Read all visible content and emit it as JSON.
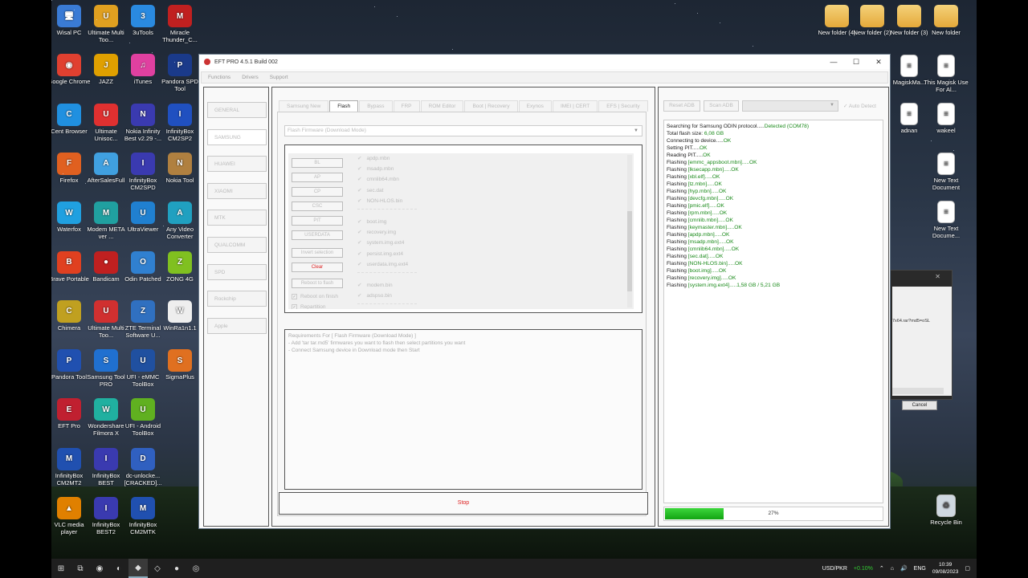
{
  "desktop": {
    "left_icons": [
      {
        "label": "Wisal PC",
        "glyph": "🖥",
        "color": "#3a7bd5"
      },
      {
        "label": "Ultimate Multi Too...",
        "glyph": "U",
        "color": "#e0a020"
      },
      {
        "label": "3uTools",
        "glyph": "3",
        "color": "#2a8ae0"
      },
      {
        "label": "Miracle Thunder_C...",
        "glyph": "M",
        "color": "#c02020"
      },
      {
        "label": "Google Chrome",
        "glyph": "◉",
        "color": "#e04030"
      },
      {
        "label": "JAZZ",
        "glyph": "J",
        "color": "#e0a000"
      },
      {
        "label": "iTunes",
        "glyph": "♫",
        "color": "#e040a0"
      },
      {
        "label": "Pandora SPD Tool",
        "glyph": "P",
        "color": "#1a3a8a"
      },
      {
        "label": "Cent Browser",
        "glyph": "C",
        "color": "#2090e0"
      },
      {
        "label": "Ultimate Unisoc...",
        "glyph": "U",
        "color": "#e03030"
      },
      {
        "label": "Nokia Infinity Best v2.29 -...",
        "glyph": "N",
        "color": "#3a3ab0"
      },
      {
        "label": "InfinityBox CM2SP2",
        "glyph": "I",
        "color": "#2050c0"
      },
      {
        "label": "Firefox",
        "glyph": "F",
        "color": "#e06020"
      },
      {
        "label": "AfterSalesFull",
        "glyph": "A",
        "color": "#40a0e0"
      },
      {
        "label": "InfinityBox CM2SPD",
        "glyph": "I",
        "color": "#3a3ab0"
      },
      {
        "label": "Nokia Tool",
        "glyph": "N",
        "color": "#b08040"
      },
      {
        "label": "Waterfox",
        "glyph": "W",
        "color": "#20a0e0"
      },
      {
        "label": "Modem META ver ...",
        "glyph": "M",
        "color": "#20a0a0"
      },
      {
        "label": "UltraViewer",
        "glyph": "U",
        "color": "#2080d0"
      },
      {
        "label": "Any Video Converter",
        "glyph": "A",
        "color": "#20a0c0"
      },
      {
        "label": "Brave Portable",
        "glyph": "B",
        "color": "#e04020"
      },
      {
        "label": "Bandicam",
        "glyph": "●",
        "color": "#c02020"
      },
      {
        "label": "Odin Patched",
        "glyph": "O",
        "color": "#3080d0"
      },
      {
        "label": "ZONG 4G",
        "glyph": "Z",
        "color": "#80c020"
      },
      {
        "label": "Chimera",
        "glyph": "C",
        "color": "#c0a020"
      },
      {
        "label": "Ultimate Multi Too...",
        "glyph": "U",
        "color": "#d03030"
      },
      {
        "label": "ZTE Terminal Software U...",
        "glyph": "Z",
        "color": "#3070c0"
      },
      {
        "label": "WinRa1n1.1",
        "glyph": "W",
        "color": "#eeeeee"
      },
      {
        "label": "Pandora Tool",
        "glyph": "P",
        "color": "#2050b0"
      },
      {
        "label": "Samsung Tool PRO",
        "glyph": "S",
        "color": "#2070d0"
      },
      {
        "label": "UFI - eMMC ToolBox",
        "glyph": "U",
        "color": "#2050a0"
      },
      {
        "label": "SigmaPlus",
        "glyph": "S",
        "color": "#e07020"
      },
      {
        "label": "EFT Pro",
        "glyph": "E",
        "color": "#c02030"
      },
      {
        "label": "Wondershare Filmora X",
        "glyph": "W",
        "color": "#20b0a0"
      },
      {
        "label": "UFI - Android ToolBox",
        "glyph": "U",
        "color": "#60b020"
      },
      {
        "label": "",
        "glyph": "",
        "color": "transparent"
      },
      {
        "label": "InfinityBox CM2MT2",
        "glyph": "M",
        "color": "#2050b0"
      },
      {
        "label": "InfinityBox BEST",
        "glyph": "I",
        "color": "#3a3ab0"
      },
      {
        "label": "dc-unlocke... [CRACKED]...",
        "glyph": "D",
        "color": "#3060c0"
      },
      {
        "label": "",
        "glyph": "",
        "color": "transparent"
      },
      {
        "label": "VLC media player",
        "glyph": "▲",
        "color": "#e08000"
      },
      {
        "label": "InfinityBox BEST2",
        "glyph": "I",
        "color": "#3a3ab0"
      },
      {
        "label": "InfinityBox CM2MTK",
        "glyph": "M",
        "color": "#2050b0"
      }
    ],
    "right_icons": [
      {
        "label": "New folder (4)",
        "kind": "folder"
      },
      {
        "label": "New folder (2)",
        "kind": "folder"
      },
      {
        "label": "New folder (3)",
        "kind": "folder"
      },
      {
        "label": "New folder",
        "kind": "folder"
      },
      {
        "label": "MagiskMa...",
        "kind": "doc"
      },
      {
        "label": "This Magisk Use For Al...",
        "kind": "doc"
      },
      {
        "label": "adnan",
        "kind": "doc"
      },
      {
        "label": "wakeel",
        "kind": "doc"
      },
      {
        "label": "New Text Document",
        "kind": "doc"
      },
      {
        "label": "New Text Docume...",
        "kind": "doc"
      },
      {
        "label": "Recycle Bin",
        "kind": "bin"
      }
    ]
  },
  "window": {
    "title": "EFT PRO 4.5.1 Build 002",
    "controls": {
      "minimize": "—",
      "maximize": "☐",
      "close": "✕"
    },
    "menu": [
      "Functions",
      "Drivers",
      "Support"
    ],
    "nav": [
      "GENERAL",
      "SAMSUNG",
      "HUAWEI",
      "XIAOMI",
      "MTK",
      "QUALCOMM",
      "SPD",
      "Rockchip",
      "Apple"
    ],
    "tabs": [
      "Samsung New",
      "Flash",
      "Bypass",
      "FRP",
      "ROM Editor",
      "Boot | Recovery",
      "Exynos",
      "IMEI | CERT",
      "EFS | Security"
    ],
    "mode_select": "Flash Firmware (Download Mode)",
    "file_buttons": [
      "BL",
      "AP",
      "CP",
      "CSC",
      "PIT",
      "USERDATA"
    ],
    "invert_label": "Invert selection",
    "clear_label": "Clear",
    "reboot_flash_label": "Reboot to flash",
    "reboot_on_finish": "Reboot on finish",
    "repartition": "Repartition",
    "partitions_a": [
      "apdp.mbn",
      "msadp.mbn",
      "cmnlib64.mbn",
      "sec.dat",
      "NON-HLOS.bin"
    ],
    "partitions_b": [
      "boot.img",
      "recovery.img",
      "system.img.ext4",
      "persist.img.ext4",
      "userdata.img.ext4"
    ],
    "partitions_c": [
      "modem.bin",
      "adspso.bin"
    ],
    "requirements": {
      "title": "Requirements For [ Flash Firmware (Download Mode) ]",
      "lines": [
        "- Add 'tar tar.md5' firmwares you want to flash then select partitions you want",
        "- Connect Samsung device in Download mode then Start"
      ]
    },
    "stop_label": "Stop",
    "right": {
      "reset_adb": "Reset ADB",
      "scan_adb": "Scan ADB",
      "auto_detect": "Auto Detect",
      "log": [
        {
          "text": "Searching for Samsung ODIN protocol.....",
          "ok": "Detected (COM78)"
        },
        {
          "text": "Total flash size: ",
          "ok": "6,08 GB"
        },
        {
          "text": "Connecting to device.....",
          "ok": "OK"
        },
        {
          "text": "Setting PIT.....",
          "ok": "OK"
        },
        {
          "text": "Reading PIT.....",
          "ok": "OK"
        },
        {
          "text": "Flashing ",
          "ok": "[emmc_appsboot.mbn]",
          "tail": ".....OK"
        },
        {
          "text": "Flashing ",
          "ok": "[lksecapp.mbn]",
          "tail": ".....OK"
        },
        {
          "text": "Flashing ",
          "ok": "[xbl.elf]",
          "tail": ".....OK"
        },
        {
          "text": "Flashing ",
          "ok": "[tz.mbn]",
          "tail": ".....OK"
        },
        {
          "text": "Flashing ",
          "ok": "[hyp.mbn]",
          "tail": ".....OK"
        },
        {
          "text": "Flashing ",
          "ok": "[devcfg.mbn]",
          "tail": ".....OK"
        },
        {
          "text": "Flashing ",
          "ok": "[pmic.elf]",
          "tail": ".....OK"
        },
        {
          "text": "Flashing ",
          "ok": "[rpm.mbn]",
          "tail": ".....OK"
        },
        {
          "text": "Flashing ",
          "ok": "[cmnlib.mbn]",
          "tail": ".....OK"
        },
        {
          "text": "Flashing ",
          "ok": "[keymaster.mbn]",
          "tail": ".....OK"
        },
        {
          "text": "Flashing ",
          "ok": "[apdp.mbn]",
          "tail": ".....OK"
        },
        {
          "text": "Flashing ",
          "ok": "[msadp.mbn]",
          "tail": ".....OK"
        },
        {
          "text": "Flashing ",
          "ok": "[cmnlib64.mbn]",
          "tail": ".....OK"
        },
        {
          "text": "Flashing ",
          "ok": "[sec.dat]",
          "tail": ".....OK"
        },
        {
          "text": "Flashing ",
          "ok": "[NON-HLOS.bin]",
          "tail": ".....OK"
        },
        {
          "text": "Flashing ",
          "ok": "[boot.img]",
          "tail": ".....OK"
        },
        {
          "text": "Flashing ",
          "ok": "[recovery.img]",
          "tail": ".....OK"
        },
        {
          "text": "Flashing ",
          "ok": "[system.img.ext4]",
          "tail": ".....1,58 GB / 5,21 GB"
        }
      ],
      "progress_value": 0.27,
      "progress_label": "27%"
    }
  },
  "bg_dialog": {
    "close": "✕",
    "path_text": "7x64.rar?md5=oSL",
    "cancel": "Cancel"
  },
  "taskbar": {
    "currency": "USD/PKR",
    "change": "+0.10%",
    "lang": "ENG",
    "time": "10:39",
    "date": "09/08/2023"
  }
}
